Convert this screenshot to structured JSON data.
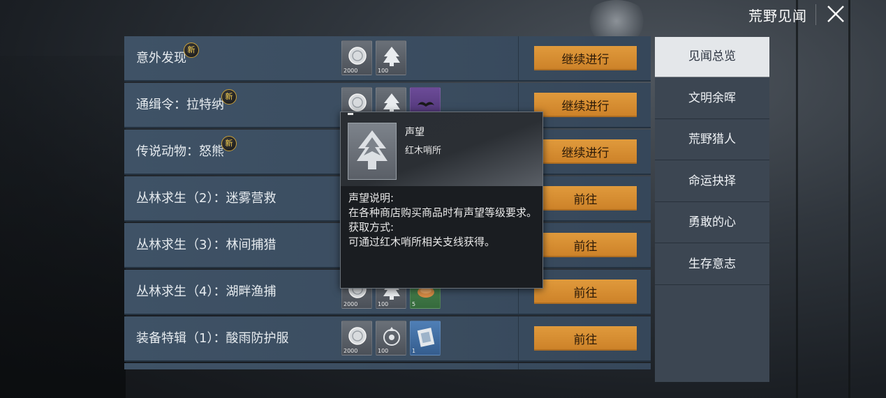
{
  "header": {
    "title": "荒野见闻",
    "close_icon": "close-icon"
  },
  "quests": [
    {
      "name": "意外发现",
      "is_new": true,
      "new_label": "新",
      "rewards": [
        {
          "icon": "silver-coin-icon",
          "qty": "2000",
          "tier": "gray"
        },
        {
          "icon": "reputation-tree-icon",
          "qty": "100",
          "tier": "gray"
        }
      ],
      "action": "继续进行",
      "partial": false
    },
    {
      "name": "通缉令：拉特纳",
      "is_new": true,
      "new_label": "新",
      "rewards": [
        {
          "icon": "silver-coin-icon",
          "qty": "",
          "tier": "gray"
        },
        {
          "icon": "reputation-tree-icon",
          "qty": "",
          "tier": "gray"
        },
        {
          "icon": "mustache-icon",
          "qty": "",
          "tier": "purple"
        }
      ],
      "action": "继续进行",
      "partial": false
    },
    {
      "name": "传说动物：怒熊",
      "is_new": true,
      "new_label": "新",
      "rewards": [],
      "action": "继续进行",
      "partial": false
    },
    {
      "name": "丛林求生（2）：迷雾营救",
      "is_new": false,
      "rewards": [],
      "action": "前往",
      "partial": false
    },
    {
      "name": "丛林求生（3）：林间捕猎",
      "is_new": false,
      "rewards": [],
      "action": "前往",
      "partial": false
    },
    {
      "name": "丛林求生（4）：湖畔渔捕",
      "is_new": false,
      "rewards": [
        {
          "icon": "silver-coin-icon",
          "qty": "2000",
          "tier": "gray"
        },
        {
          "icon": "reputation-tree-icon",
          "qty": "100",
          "tier": "gray"
        },
        {
          "icon": "food-icon",
          "qty": "5",
          "tier": "green"
        }
      ],
      "action": "前往",
      "partial": false
    },
    {
      "name": "装备特辑（1）：酸雨防护服",
      "is_new": false,
      "rewards": [
        {
          "icon": "silver-coin-icon",
          "qty": "2000",
          "tier": "gray"
        },
        {
          "icon": "radiation-emblem-icon",
          "qty": "100",
          "tier": "gray"
        },
        {
          "icon": "blueprint-icon",
          "qty": "1",
          "tier": "blue"
        }
      ],
      "action": "前往",
      "partial": false
    },
    {
      "name": "",
      "is_new": false,
      "rewards": [],
      "action": "",
      "partial": true
    }
  ],
  "tooltip": {
    "item_name": "声望",
    "source": "红木哨所",
    "desc_heading": "声望说明:",
    "desc_text": "在各种商店购买商品时有声望等级要求。",
    "obtain_heading": "获取方式:",
    "obtain_text": "可通过红木哨所相关支线获得。"
  },
  "sidebar": {
    "active_index": 0,
    "tabs": [
      "见闻总览",
      "文明余晖",
      "荒野猎人",
      "命运抉择",
      "勇敢的心",
      "生存意志"
    ]
  },
  "colors": {
    "accent_button": "#d98c32",
    "row_bg": "#3d5064",
    "sidebar_bg": "#3c4652",
    "active_tab": "#e4e7ea"
  }
}
